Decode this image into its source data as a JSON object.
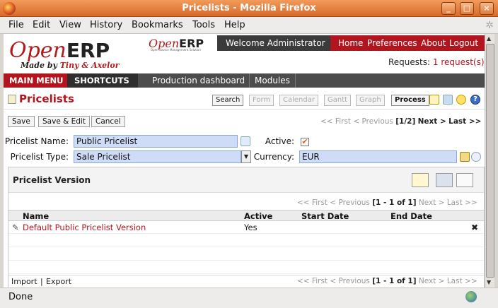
{
  "window": {
    "title": "Pricelists - Mozilla Firefox",
    "minimize": "_",
    "maximize": "□",
    "close": "×"
  },
  "menubar": [
    "File",
    "Edit",
    "View",
    "History",
    "Bookmarks",
    "Tools",
    "Help"
  ],
  "header": {
    "logo_open": "Open",
    "logo_erp": "ERP",
    "logo_made_by": "Made by",
    "logo_makers": "Tiny & Axelor",
    "logo2_open": "Open",
    "logo2_erp": "ERP",
    "logo2_tagline": "Open Source Management Solution",
    "welcome": "Welcome Administrator",
    "links": [
      "Home",
      "Preferences",
      "About",
      "Logout"
    ],
    "requests_label": "Requests:",
    "requests_value": "1 request(s)"
  },
  "nav": {
    "main_menu": "MAIN MENU",
    "shortcuts": "SHORTCUTS",
    "tabs": [
      "Production dashboard",
      "Modules"
    ]
  },
  "page": {
    "title": "Pricelists",
    "views": [
      "Search",
      "Form",
      "Calendar",
      "Gantt",
      "Graph",
      "Process"
    ]
  },
  "actions": {
    "save": "Save",
    "save_edit": "Save & Edit",
    "cancel": "Cancel"
  },
  "pager_main": {
    "first": "<< First",
    "previous": "< Previous",
    "position": "[1/2]",
    "next": "Next >",
    "last": "Last >>"
  },
  "form": {
    "name_label": "Pricelist Name:",
    "name_value": "Public Pricelist",
    "type_label": "Pricelist Type:",
    "type_value": "Sale Pricelist",
    "active_label": "Active:",
    "active_checked": true,
    "active_mark": "✔",
    "currency_label": "Currency:",
    "currency_value": "EUR"
  },
  "versions": {
    "title": "Pricelist Version",
    "pager": {
      "first": "<< First",
      "previous": "< Previous",
      "position": "[1 - 1 of 1]",
      "next": "Next >",
      "last": "Last >>"
    },
    "columns": [
      "Name",
      "Active",
      "Start Date",
      "End Date"
    ],
    "rows": [
      {
        "name": "Default Public Pricelist Version",
        "active": "Yes",
        "start": "",
        "end": ""
      }
    ],
    "import": "Import",
    "separator": "|",
    "export": "Export",
    "delete_mark": "✖"
  },
  "status": {
    "text": "Done"
  },
  "colors": {
    "accent": "#b2151d",
    "input_bg": "#cfdcf7",
    "titlebar": "#e07a3a"
  }
}
